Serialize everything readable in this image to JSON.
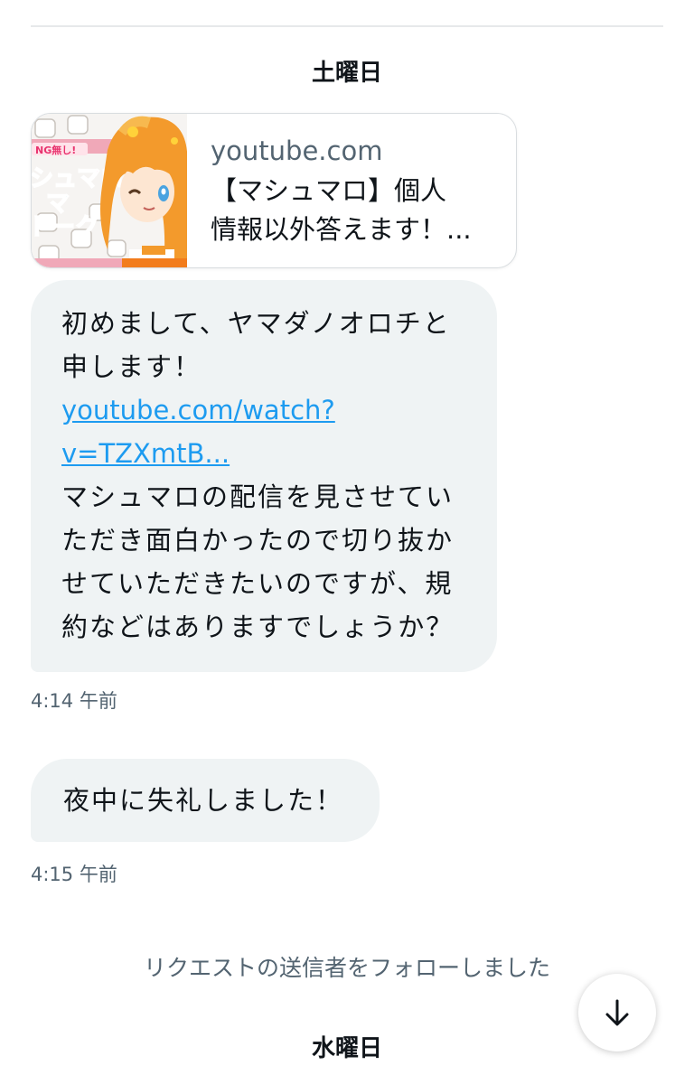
{
  "days": {
    "first": "土曜日",
    "second": "水曜日"
  },
  "link_card": {
    "domain": "youtube.com",
    "title": "【マシュマロ】個人情報以外答えます！...",
    "title_line1": "【マシュマロ】個人",
    "title_line2": "情報以外答えます！...",
    "thumbnail": {
      "banner_text": "NG無し!",
      "big_text_1": "シュマロ",
      "big_text_2": "マ",
      "big_text_3": "トーク"
    }
  },
  "messages": [
    {
      "text_before_link": "初めまして、ヤマダノオロチと申します！",
      "link_text": "youtube.com/watch?v=TZXmtB...",
      "link_line1": "youtube.com/watch?",
      "link_line2": "v=TZXmtB...",
      "text_after_link": "マシュマロの配信を見させていただき面白かったので切り抜かせていただきたいのですが、規約などはありますでしょうか？",
      "time": "4:14 午前"
    },
    {
      "text": "夜中に失礼しました！",
      "time": "4:15 午前"
    }
  ],
  "system_message": "リクエストの送信者をフォローしました",
  "scroll_button": {
    "icon": "arrow-down-icon"
  },
  "colors": {
    "bubble_bg": "#eff3f4",
    "link": "#1d9bf0",
    "secondary_text": "#536471",
    "primary_text": "#0f1419"
  }
}
